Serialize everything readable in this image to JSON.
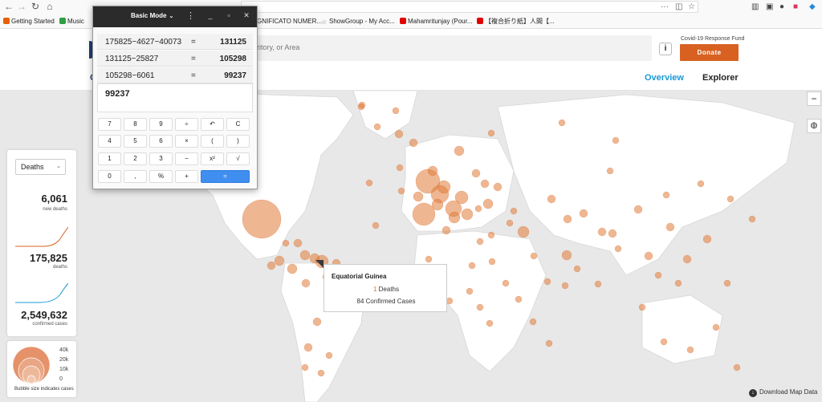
{
  "browser": {
    "bookmarks": [
      {
        "label": "Getting Started",
        "color": "#e66000"
      },
      {
        "label": "Music",
        "color": "#2e9e44"
      },
      {
        "label": "GNIFICATO NUMER...",
        "color": "#999999"
      },
      {
        "label": "ShowGroup - My Acc...",
        "color": "#777777"
      },
      {
        "label": "Mahamritunjay (Pour...",
        "color": "#e00000"
      },
      {
        "label": "【複合折り紙】人間【...",
        "color": "#e00000"
      }
    ]
  },
  "site": {
    "search_placeholder": "rritory, or Area",
    "info_label": "i",
    "fund_label": "Covid-19 Response Fund",
    "donate_label": "Donate",
    "tabs": [
      {
        "label": "Overview",
        "active": true
      },
      {
        "label": "Explorer",
        "active": false
      }
    ],
    "logo_letter": "C",
    "accent_color": "#d86121",
    "link_color": "#1a9ad6"
  },
  "stats": {
    "metric": "Deaths",
    "new_deaths": "6,061",
    "new_deaths_label": "new deaths",
    "deaths": "175,825",
    "deaths_label": "deaths",
    "confirmed": "2,549,632",
    "confirmed_label": "confirmed cases"
  },
  "legend": {
    "values": [
      "40k",
      "20k",
      "10k",
      "0"
    ],
    "caption": "Bubble size indicates cases"
  },
  "tooltip": {
    "country": "Equatorial Guinea",
    "deaths_value": "1",
    "deaths_label": "Deaths",
    "confirmed_text": "84 Confirmed Cases"
  },
  "download_label": "Download Map Data",
  "calculator": {
    "mode": "Basic Mode",
    "history": [
      {
        "expr": "175825−4627−40073",
        "result": "131125"
      },
      {
        "expr": "131125−25827",
        "result": "105298"
      },
      {
        "expr": "105298−6061",
        "result": "99237"
      }
    ],
    "display": "99237",
    "keys": [
      [
        "7",
        "8",
        "9",
        "÷",
        "↶",
        "C"
      ],
      [
        "4",
        "5",
        "6",
        "×",
        "(",
        ")"
      ],
      [
        "1",
        "2",
        "3",
        "−",
        "x²",
        "√"
      ],
      [
        "0",
        ",",
        "%",
        "+",
        "="
      ]
    ]
  }
}
